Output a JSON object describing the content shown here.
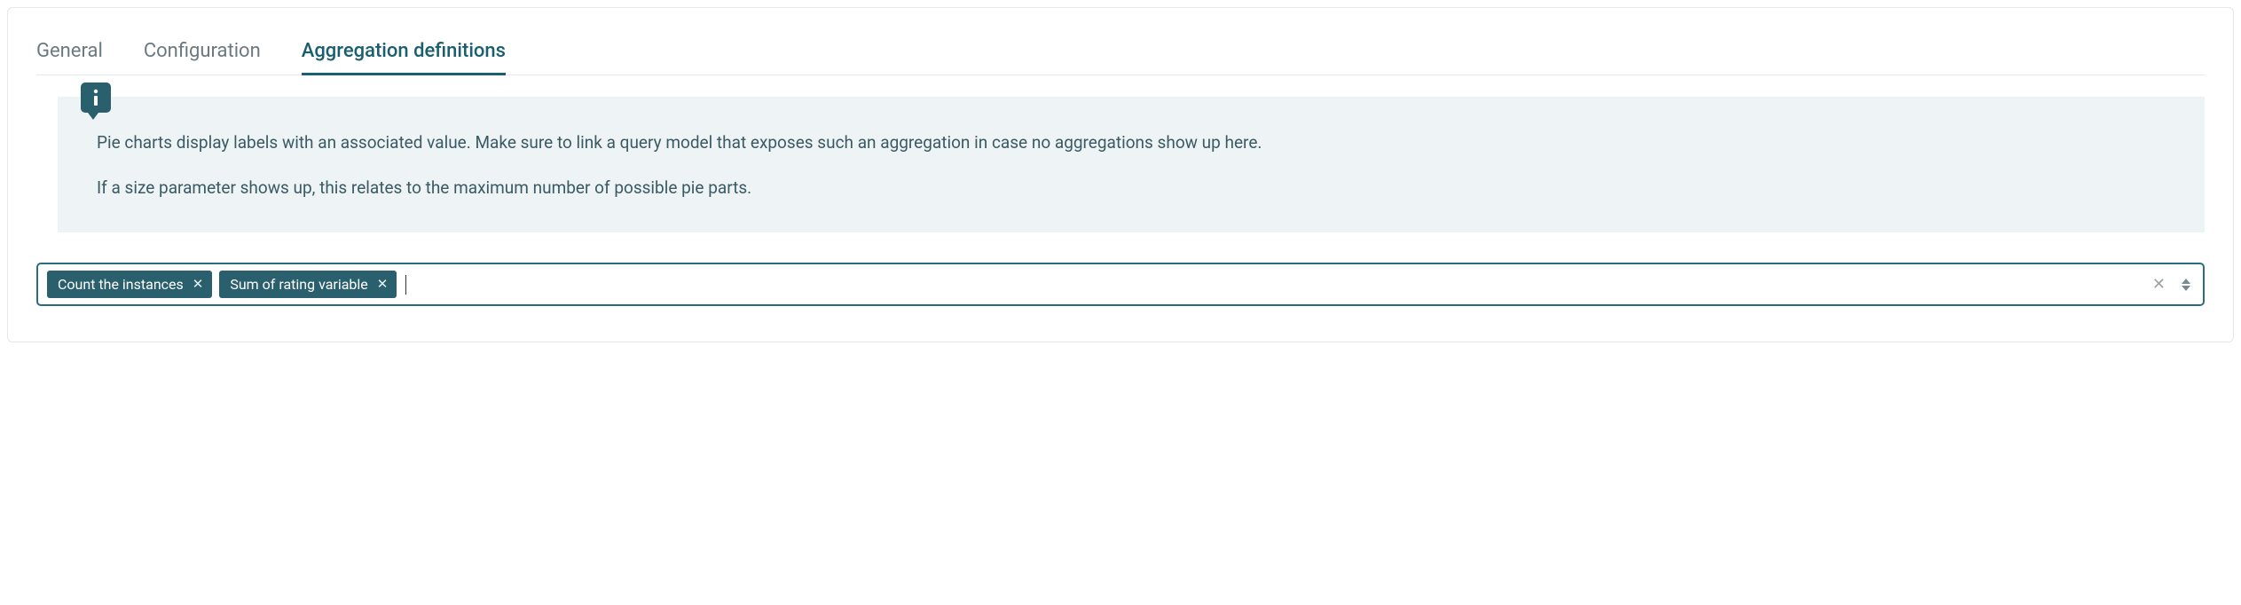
{
  "tabs": {
    "general": "General",
    "configuration": "Configuration",
    "aggregation": "Aggregation definitions"
  },
  "info": {
    "line1": "Pie charts display labels with an associated value. Make sure to link a query model that exposes such an aggregation in case no aggregations show up here.",
    "line2": "If a size parameter shows up, this relates to the maximum number of possible pie parts."
  },
  "tags": {
    "items": [
      {
        "label": "Count the instances"
      },
      {
        "label": "Sum of rating variable"
      }
    ]
  }
}
